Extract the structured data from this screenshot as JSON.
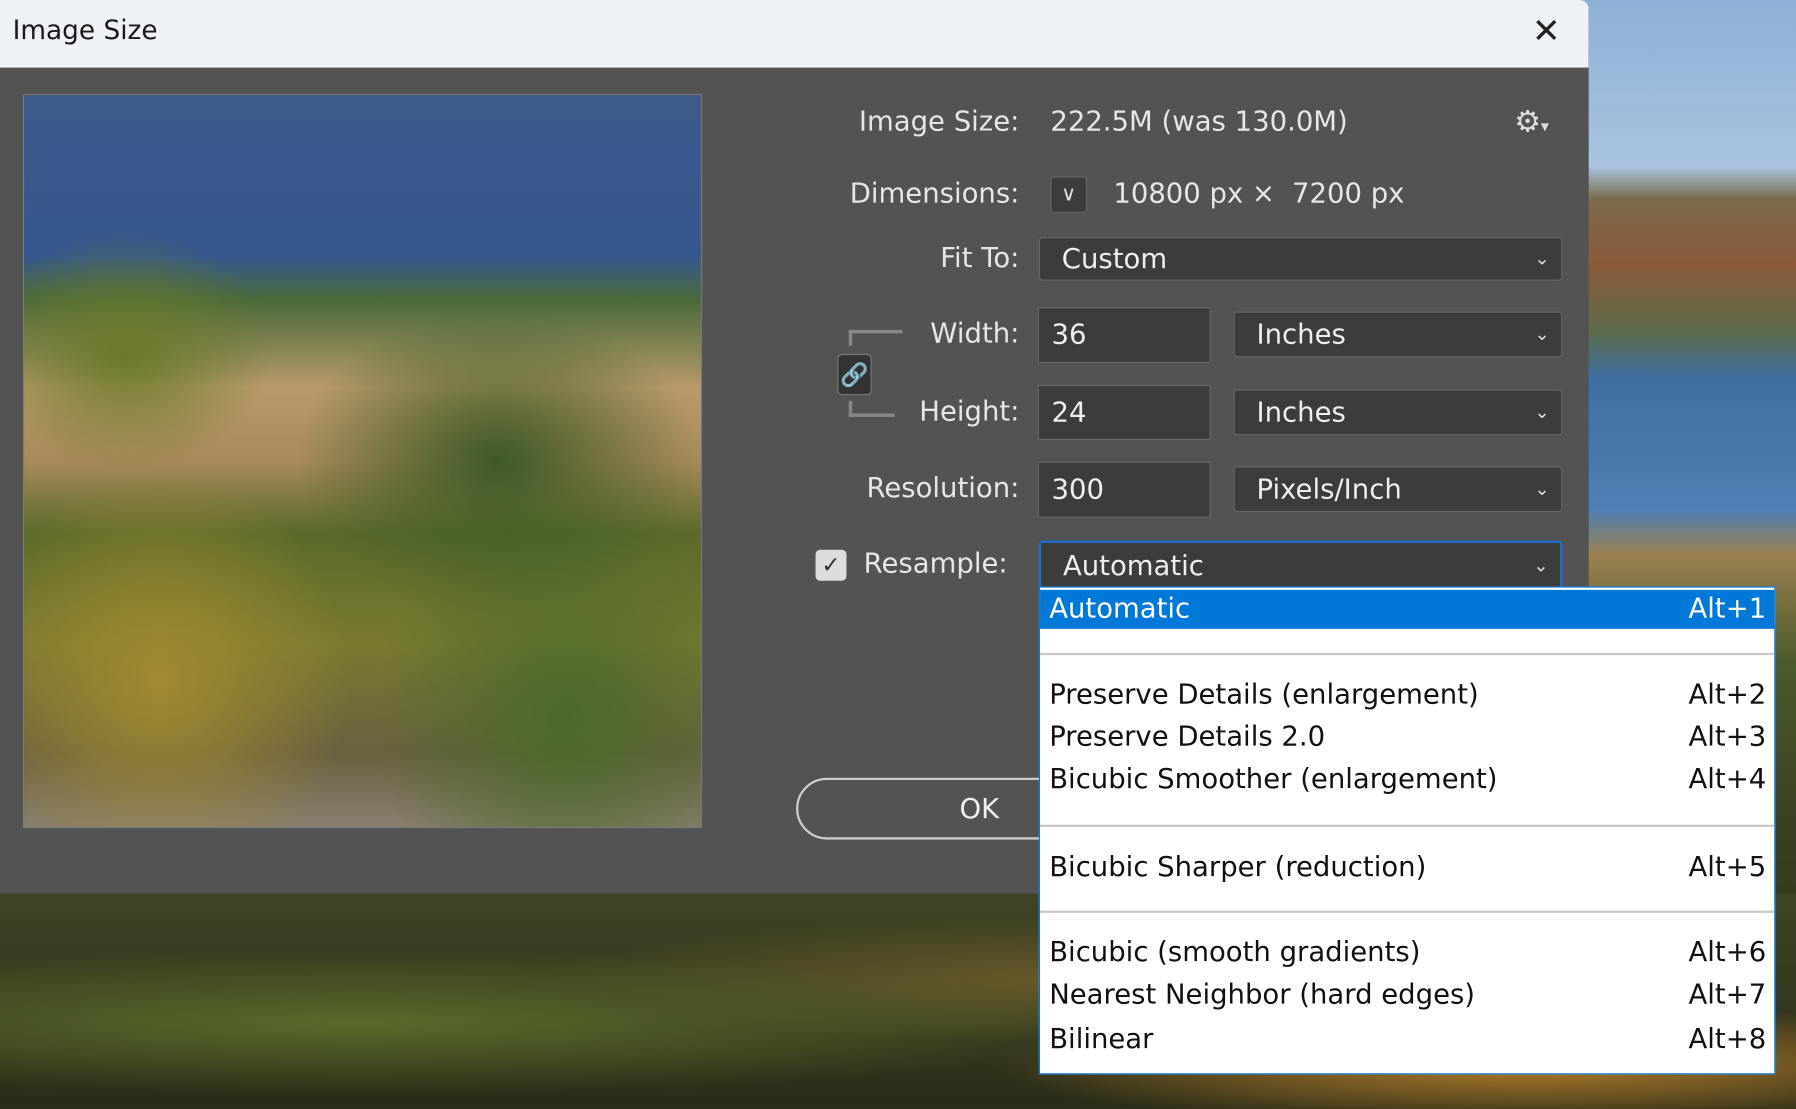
{
  "dialog": {
    "title": "Image Size",
    "close_icon": "close-x",
    "image_size_label": "Image Size:",
    "image_size_value": "222.5M (was 130.0M)",
    "settings_icon": "gear-icon",
    "dimensions_label": "Dimensions:",
    "dimensions_width": "10800 px",
    "dimensions_times": "×",
    "dimensions_height": "7200 px",
    "fit_to_label": "Fit To:",
    "fit_to_value": "Custom",
    "width_label": "Width:",
    "width_value": "36",
    "width_unit": "Inches",
    "height_label": "Height:",
    "height_value": "24",
    "height_unit": "Inches",
    "resolution_label": "Resolution:",
    "resolution_value": "300",
    "resolution_unit": "Pixels/Inch",
    "resample_label": "Resample:",
    "resample_checked": true,
    "resample_value": "Automatic",
    "ok_label": "OK",
    "accent_color": "#0078d7"
  },
  "resample_menu": {
    "items": [
      {
        "label": "Automatic",
        "shortcut": "Alt+1",
        "selected": true
      },
      {
        "label": "Preserve Details (enlargement)",
        "shortcut": "Alt+2"
      },
      {
        "label": "Preserve Details 2.0",
        "shortcut": "Alt+3"
      },
      {
        "label": "Bicubic Smoother (enlargement)",
        "shortcut": "Alt+4"
      },
      {
        "label": "Bicubic Sharper (reduction)",
        "shortcut": "Alt+5"
      },
      {
        "label": "Bicubic (smooth gradients)",
        "shortcut": "Alt+6"
      },
      {
        "label": "Nearest Neighbor (hard edges)",
        "shortcut": "Alt+7"
      },
      {
        "label": "Bilinear",
        "shortcut": "Alt+8"
      }
    ]
  }
}
